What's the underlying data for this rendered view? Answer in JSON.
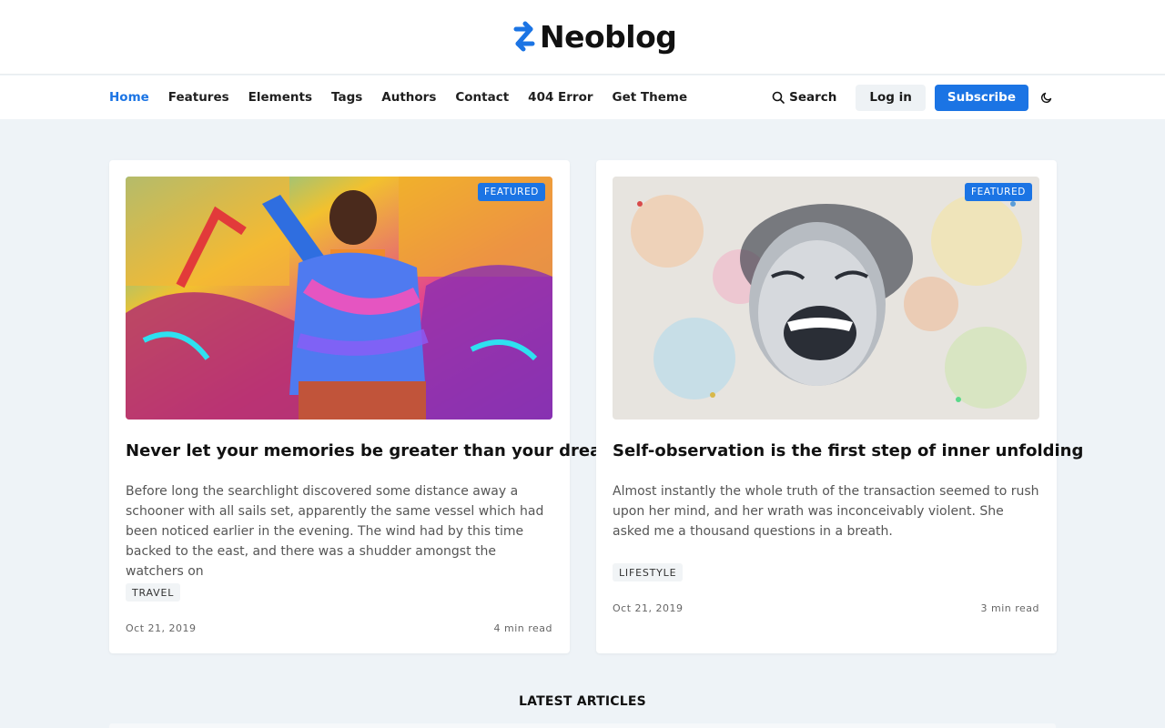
{
  "brand": {
    "name": "Neoblog",
    "accent": "#1b74e4"
  },
  "nav": {
    "items": [
      {
        "label": "Home",
        "active": true
      },
      {
        "label": "Features"
      },
      {
        "label": "Elements"
      },
      {
        "label": "Tags"
      },
      {
        "label": "Authors"
      },
      {
        "label": "Contact"
      },
      {
        "label": "404 Error"
      },
      {
        "label": "Get Theme"
      }
    ],
    "search_label": "Search",
    "login_label": "Log in",
    "subscribe_label": "Subscribe",
    "theme_icon": "moon-icon"
  },
  "posts": [
    {
      "badge": "FEATURED",
      "title": "Never let your memories be greater than your dreams",
      "excerpt": "Before long the searchlight discovered some distance away a schooner with all sails set, apparently the same vessel which had been noticed earlier in the evening. The wind had by this time backed to the east, and there was a shudder amongst the watchers on",
      "tag": "TRAVEL",
      "date": "Oct 21, 2019",
      "read_time": "4 min read"
    },
    {
      "badge": "FEATURED",
      "title": "Self-observation is the first step of inner unfolding",
      "excerpt": "Almost instantly the whole truth of the transaction seemed to rush upon her mind, and her wrath was inconceivably violent. She asked me a thousand questions in a breath.",
      "tag": "LIFESTYLE",
      "date": "Oct 21, 2019",
      "read_time": "3 min read"
    }
  ],
  "section": {
    "latest_heading": "LATEST ARTICLES"
  }
}
